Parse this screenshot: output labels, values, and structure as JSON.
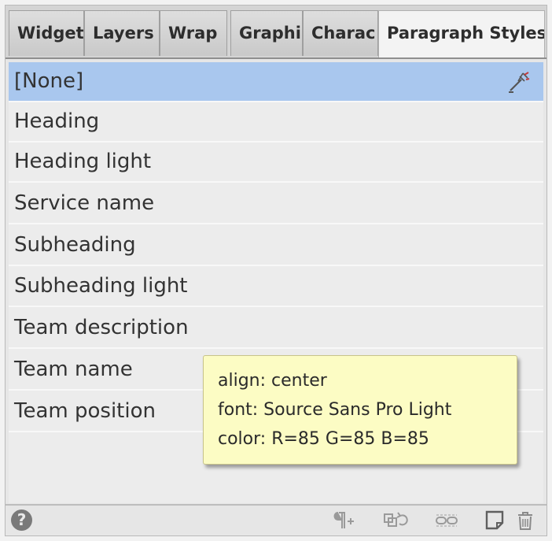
{
  "tabs": [
    {
      "label": "Widget"
    },
    {
      "label": "Layers"
    },
    {
      "label": "Wrap"
    },
    {
      "label": "Graphi"
    },
    {
      "label": "Charac"
    },
    {
      "label": "Paragraph Styles"
    }
  ],
  "styles": [
    {
      "label": "[None]"
    },
    {
      "label": "Heading"
    },
    {
      "label": "Heading light"
    },
    {
      "label": "Service name"
    },
    {
      "label": "Subheading"
    },
    {
      "label": "Subheading light"
    },
    {
      "label": "Team description"
    },
    {
      "label": "Team name"
    },
    {
      "label": "Team position"
    }
  ],
  "tooltip": {
    "line1": "align: center",
    "line2": "font: Source Sans Pro Light",
    "line3": "color: R=85 G=85 B=85"
  },
  "footer": {
    "help_glyph": "?"
  },
  "icons": {
    "quick_apply": "quick-apply-icon",
    "help": "help-icon",
    "paragraph_style_override": "paragraph-override-icon",
    "sync_styles": "sync-styles-icon",
    "link_styles": "link-styles-icon",
    "new_style": "new-style-icon",
    "delete": "trash-icon"
  },
  "colors": {
    "selected_row": "#a9c7ee",
    "tooltip_bg": "#fcfcc4"
  }
}
